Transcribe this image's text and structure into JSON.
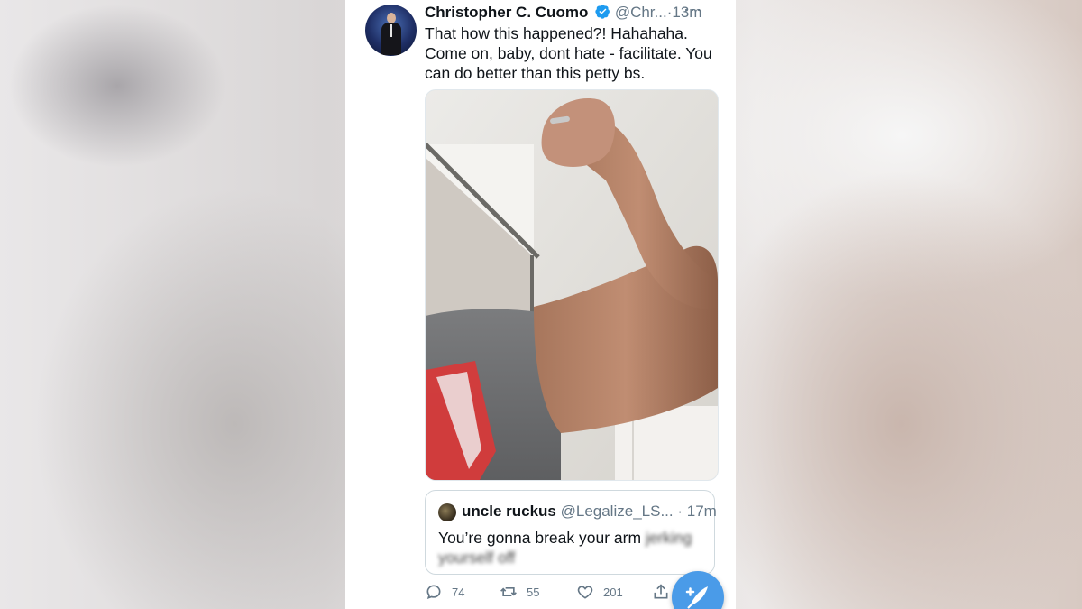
{
  "tweet": {
    "author_name": "Christopher C. Cuomo",
    "handle": "@Chr...",
    "separator": "·",
    "time": "13m",
    "more": "···",
    "text": "That how this happened?!  Hahahaha. Come on, baby, dont hate - facilitate. You can do better than this petty bs."
  },
  "quoted": {
    "author_name": "uncle ruckus",
    "handle": "@Legalize_LS...",
    "separator": "·",
    "time": "17m",
    "text": "You’re gonna break your arm",
    "blurred_text": "jerking yourself off"
  },
  "actions": {
    "replies": "74",
    "retweets": "55",
    "likes": "201"
  },
  "colors": {
    "accent": "#4a9be8",
    "verified": "#1d9bf0",
    "secondary_text": "#657786"
  },
  "icons": [
    "verified-badge-icon",
    "more-icon",
    "reply-icon",
    "retweet-icon",
    "like-icon",
    "share-icon",
    "compose-tweet-icon"
  ]
}
